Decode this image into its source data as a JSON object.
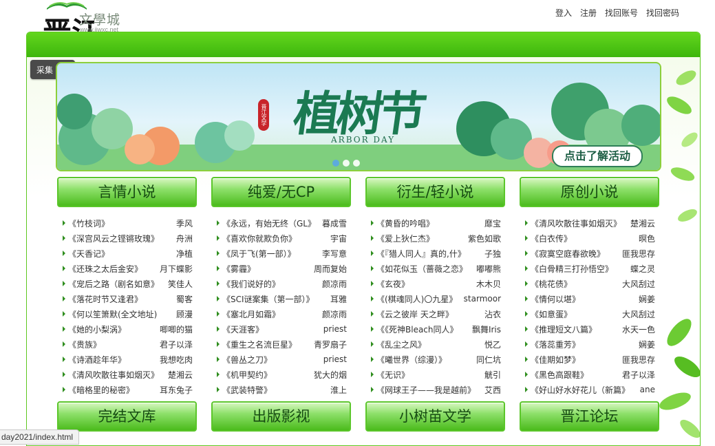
{
  "logo": {
    "brand": "晋江",
    "name": "文學城",
    "url": "www.jjwxc.net"
  },
  "header": {
    "links": [
      "登入",
      "注册",
      "找回账号",
      "找回密码"
    ]
  },
  "collect": {
    "label": "采集"
  },
  "banner": {
    "title": "植树节",
    "subtitle": "ARBOR DAY",
    "seal": "晋江文学",
    "cta": "点击了解活动"
  },
  "columns": [
    {
      "header": "言情小说",
      "items": [
        [
          "《竹枝词》",
          "季风"
        ],
        [
          "《深宫风云之铿锵玫瑰》",
          "舟洲"
        ],
        [
          "《天香记》",
          "净植"
        ],
        [
          "《还珠之太后金安》",
          "月下蝶影"
        ],
        [
          "《宠后之路（剧名如意》",
          "笑佳人"
        ],
        [
          "《落花时节又逢君》",
          "蜀客"
        ],
        [
          "《何以笙箫默(全文地址)",
          "顾漫"
        ],
        [
          "《她的小梨涡》",
          "唧唧的猫"
        ],
        [
          "《贵族》",
          "君子以泽"
        ],
        [
          "《诗酒趁年华》",
          "我想吃肉"
        ],
        [
          "《清风吹散往事如烟灭》",
          "楚湘云"
        ],
        [
          "《暗格里的秘密》",
          "耳东兔子"
        ]
      ]
    },
    {
      "header": "纯爱/无CP",
      "items": [
        [
          "《永远，有始无终（GL》",
          "暮成雪"
        ],
        [
          "《喜欢你就欺负你》",
          "宇宙"
        ],
        [
          "《凤于飞(第一部）》",
          "李写意"
        ],
        [
          "《雾霾》",
          "周而复始"
        ],
        [
          "《我们说好的》",
          "颜凉雨"
        ],
        [
          "《SCI谜案集（第一部）》",
          "耳雅"
        ],
        [
          "《塞北月如霜》",
          "颜凉雨"
        ],
        [
          "《天涯客》",
          "priest"
        ],
        [
          "《重生之名流巨星》",
          "青罗扇子"
        ],
        [
          "《兽丛之刀》",
          "priest"
        ],
        [
          "《机甲契约》",
          "犹大的烟"
        ],
        [
          "《武装特警》",
          "淮上"
        ]
      ]
    },
    {
      "header": "衍生/轻小说",
      "items": [
        [
          "《黄昏的吟唱》",
          "靡宝"
        ],
        [
          "《爱上狄仁杰》",
          "紫色如歌"
        ],
        [
          "《『猎人同人』真的,什》",
          "子独"
        ],
        [
          "《如花似玉（蔷薇之恋》",
          "嘟嘟熊"
        ],
        [
          "《玄夜》",
          "木木贝"
        ],
        [
          "《(棋魂同人)〇九星》",
          "starmoor"
        ],
        [
          "《云之彼岸 天之畔》",
          "沾衣"
        ],
        [
          "《《死神Bleach同人》",
          "飘舞Iris"
        ],
        [
          "《乱尘之风》",
          "悦乙"
        ],
        [
          "《曦世界（综漫）》",
          "同仁坑"
        ],
        [
          "《无识》",
          "觥引"
        ],
        [
          "《网球王子——我是越前》",
          "艾西"
        ]
      ]
    },
    {
      "header": "原创小说",
      "items": [
        [
          "《清风吹散往事如烟灭》",
          "楚湘云"
        ],
        [
          "《白衣传》",
          "暝色"
        ],
        [
          "《寂寞空庭春欲晚》",
          "匪我思存"
        ],
        [
          "《白骨精三打孙悟空》",
          "蝶之灵"
        ],
        [
          "《桃花债》",
          "大风刮过"
        ],
        [
          "《情何以堪》",
          "娴姜"
        ],
        [
          "《如意蛋》",
          "大风刮过"
        ],
        [
          "《推理短文八篇》",
          "水天一色"
        ],
        [
          "《落蕊重芳》",
          "娴姜"
        ],
        [
          "《佳期如梦》",
          "匪我思存"
        ],
        [
          "《黑色高跟鞋》",
          "君子以泽"
        ],
        [
          "《好山好水好花儿（新篇》",
          "ane"
        ]
      ]
    }
  ],
  "bottom_categories": [
    "完结文库",
    "出版影视",
    "小树苗文学",
    "晋江论坛"
  ],
  "status_url": "day2021/index.html",
  "colors": {
    "accent_green": "#4bbb1c",
    "header_text": "#164b12",
    "arrow": "#2f8e1e"
  }
}
